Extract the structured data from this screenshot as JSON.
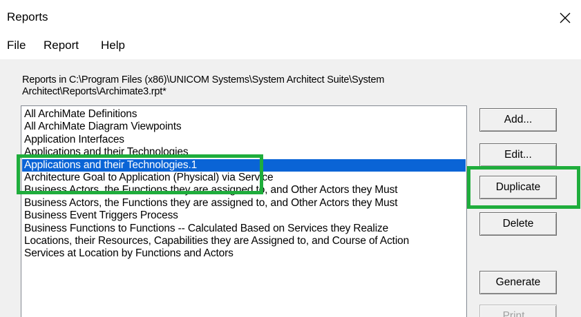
{
  "window": {
    "title": "Reports",
    "close_glyph": "✕"
  },
  "menu": {
    "items": [
      "File",
      "Report",
      "Help"
    ]
  },
  "path_label": {
    "line1": "Reports in C:\\Program Files (x86)\\UNICOM Systems\\System Architect Suite\\System",
    "line2": "Architect\\Reports\\Archimate3.rpt*"
  },
  "reports": {
    "items": [
      "All ArchiMate Definitions",
      "All ArchiMate Diagram Viewpoints",
      "Application Interfaces",
      "Applications and their Technologies",
      "Applications and their Technologies.1",
      "Architecture Goal to Application (Physical) via Service",
      "Business Actors, the Functions they are assigned to, and Other Actors they Must",
      "Business Actors, the Functions they are assigned to, and Other Actors they Must",
      "Business Event Triggers Process",
      "Business Functions to Functions -- Calculated Based on Services they Realize",
      "Locations, their Resources, Capabilities they are Assigned to, and Course of Action",
      "Services at Location by Functions and Actors"
    ],
    "selected_index": 4
  },
  "buttons": {
    "add": "Add...",
    "edit": "Edit...",
    "duplicate": "Duplicate",
    "delete": "Delete",
    "generate": "Generate",
    "print": "Print..."
  },
  "colors": {
    "selection": "#0a64d6",
    "highlight": "#1fad3c"
  }
}
